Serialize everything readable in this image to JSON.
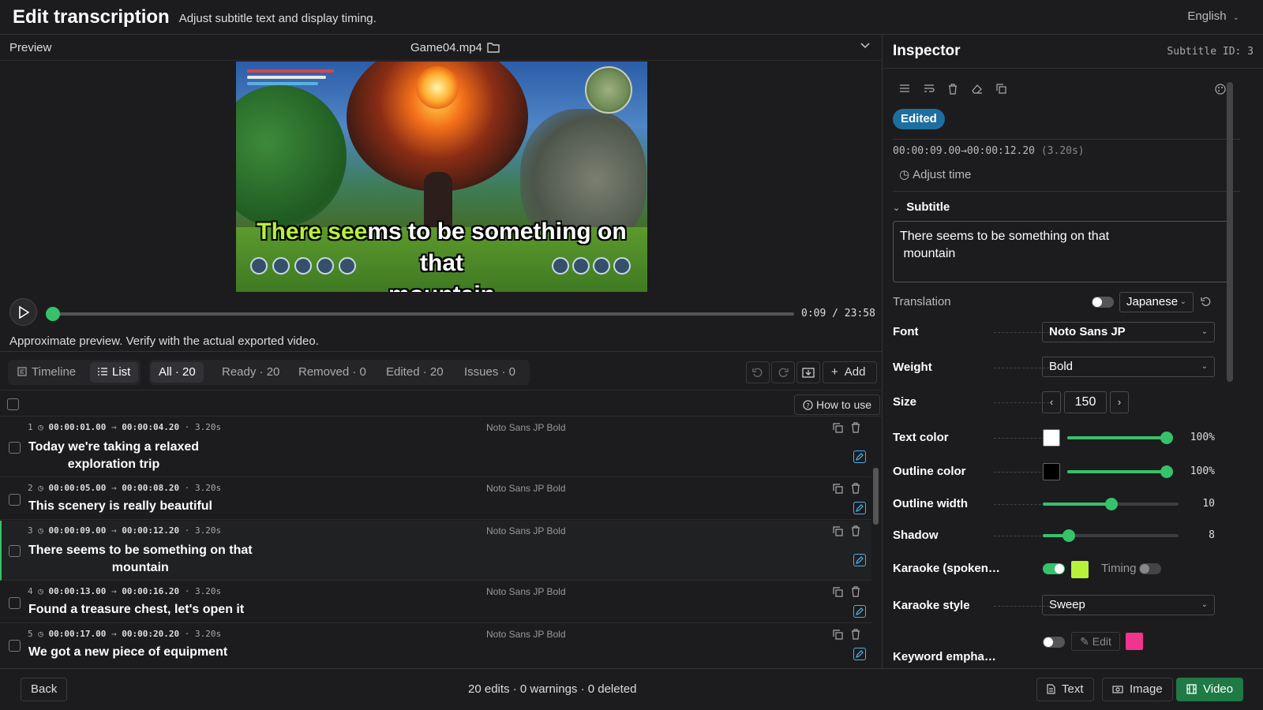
{
  "header": {
    "title": "Edit transcription",
    "subtitle": "Adjust subtitle text and display timing.",
    "language": "English"
  },
  "preview": {
    "label": "Preview",
    "file_name": "Game04.mp4",
    "caption_highlight": "There see",
    "caption_rest": "ms to be something on that",
    "caption_line2": "mountain",
    "time": "0:09 / 23:58",
    "progress_fraction": 0.006,
    "note": "Approximate preview. Verify with the actual exported video."
  },
  "view_tabs": {
    "timeline": "Timeline",
    "list": "List"
  },
  "filters": {
    "all": "All · 20",
    "ready": "Ready · 20",
    "removed": "Removed · 0",
    "edited": "Edited · 20",
    "issues": "Issues · 0"
  },
  "actions": {
    "add": "Add",
    "how_to_use": "How to use"
  },
  "rows": [
    {
      "index": "1",
      "start": "00:00:01.00",
      "end": "00:00:04.20",
      "duration": "3.20s",
      "font": "Noto Sans JP Bold",
      "line1": "Today we're taking a relaxed",
      "line2": "exploration trip"
    },
    {
      "index": "2",
      "start": "00:00:05.00",
      "end": "00:00:08.20",
      "duration": "3.20s",
      "font": "Noto Sans JP Bold",
      "line1": "This scenery is really beautiful",
      "line2": ""
    },
    {
      "index": "3",
      "start": "00:00:09.00",
      "end": "00:00:12.20",
      "duration": "3.20s",
      "font": "Noto Sans JP Bold",
      "line1": "There seems to be something on that",
      "line2": "mountain"
    },
    {
      "index": "4",
      "start": "00:00:13.00",
      "end": "00:00:16.20",
      "duration": "3.20s",
      "font": "Noto Sans JP Bold",
      "line1": "Found a treasure chest, let's open it",
      "line2": ""
    },
    {
      "index": "5",
      "start": "00:00:17.00",
      "end": "00:00:20.20",
      "duration": "3.20s",
      "font": "Noto Sans JP Bold",
      "line1": "We got a new piece of equipment",
      "line2": ""
    }
  ],
  "inspector": {
    "title": "Inspector",
    "subtitle_id": "Subtitle ID: 3",
    "badge": "Edited",
    "time_range": "00:00:09.00→00:00:12.20",
    "duration": "(3.20s)",
    "adjust_time": "Adjust time",
    "section_subtitle": "Subtitle",
    "subtitle_text": "There seems to be something on that\n mountain",
    "translation_label": "Translation",
    "translation_lang": "Japanese",
    "font_label": "Font",
    "font_value": "Noto Sans JP",
    "weight_label": "Weight",
    "weight_value": "Bold",
    "size_label": "Size",
    "size_value": "150",
    "text_color_label": "Text color",
    "text_color": "#ffffff",
    "text_opacity": "100%",
    "outline_color_label": "Outline color",
    "outline_color": "#000000",
    "outline_opacity": "100%",
    "outline_width_label": "Outline width",
    "outline_width": "10",
    "shadow_label": "Shadow",
    "shadow": "8",
    "karaoke_label": "Karaoke (spoken…",
    "karaoke_color": "#b6f23a",
    "timing_label": "Timing",
    "karaoke_style_label": "Karaoke style",
    "karaoke_style": "Sweep",
    "keyword_label": "Keyword empha…",
    "keyword_edit": "Edit",
    "keyword_color": "#f0358a"
  },
  "footer": {
    "back": "Back",
    "status": "20 edits · 0 warnings · 0 deleted",
    "text": "Text",
    "image": "Image",
    "video": "Video"
  },
  "colors": {
    "accent_green": "#36c26a",
    "edit_blue": "#4fb0e8",
    "badge_blue": "#1d6fa0"
  }
}
